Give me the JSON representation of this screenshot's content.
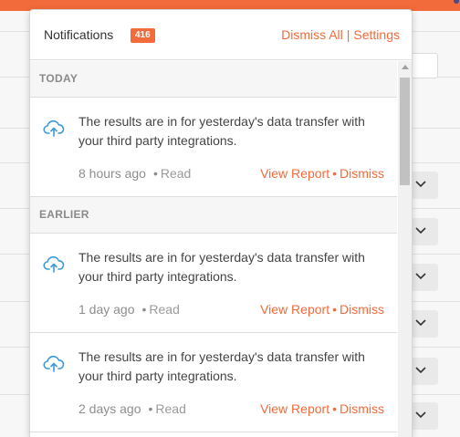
{
  "colors": {
    "accent": "#f26b3a",
    "icon": "#3a9ad9"
  },
  "notifications": {
    "title": "Notifications",
    "count": "416",
    "dismiss_all": "Dismiss All",
    "separator": "|",
    "settings": "Settings",
    "sections": [
      {
        "label": "TODAY",
        "items": [
          {
            "icon": "cloud-upload-icon",
            "text": "The results are in for yesterday's data transfer with your third party integrations.",
            "time": "8 hours ago",
            "status": "Read",
            "view": "View Report",
            "dismiss": "Dismiss"
          }
        ]
      },
      {
        "label": "EARLIER",
        "items": [
          {
            "icon": "cloud-upload-icon",
            "text": "The results are in for yesterday's data transfer with your third party integrations.",
            "time": "1 day ago",
            "status": "Read",
            "view": "View Report",
            "dismiss": "Dismiss"
          },
          {
            "icon": "cloud-upload-icon",
            "text": "The results are in for yesterday's data transfer with your third party integrations.",
            "time": "2 days ago",
            "status": "Read",
            "view": "View Report",
            "dismiss": "Dismiss"
          }
        ]
      }
    ]
  }
}
